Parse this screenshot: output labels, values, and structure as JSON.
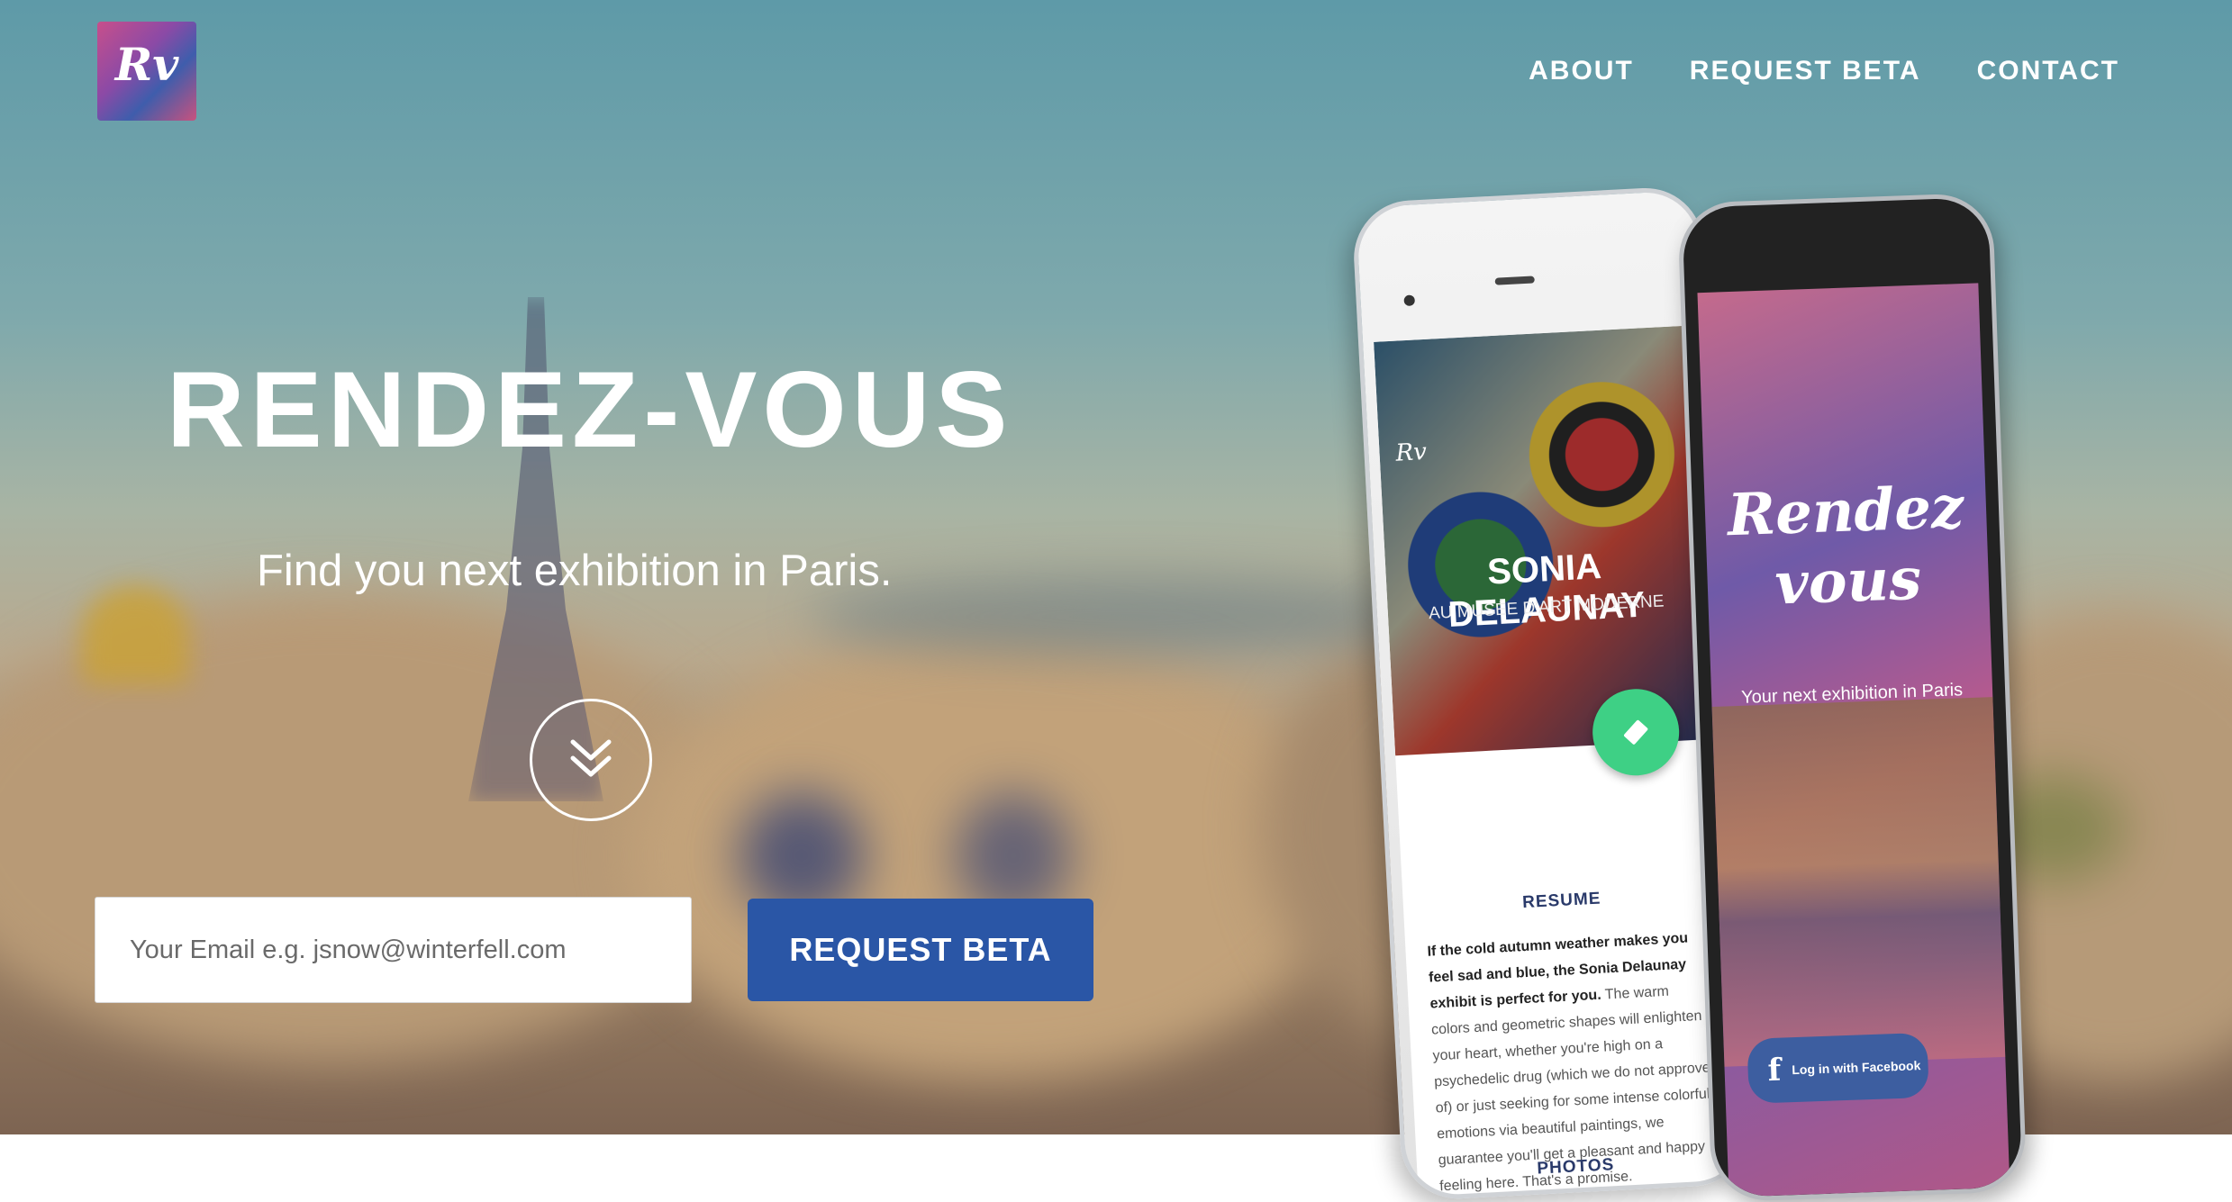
{
  "brand": {
    "logo_text": "Rv"
  },
  "nav": {
    "items": [
      "ABOUT",
      "REQUEST BETA",
      "CONTACT"
    ]
  },
  "hero": {
    "title": "RENDEZ-VOUS",
    "subtitle": "Find you next exhibition in Paris.",
    "scroll_icon": "double-chevron-down-icon",
    "email_placeholder": "Your Email e.g. jsnow@winterfell.com",
    "cta_label": "REQUEST BETA"
  },
  "phone_left": {
    "logo": "Rv",
    "exhibit_title": "SONIA DELAUNAY",
    "exhibit_subtitle": "AU MUSÉE D'ART MODERNE",
    "resume_heading": "RESUME",
    "resume_lead": "If the cold autumn weather makes you feel sad and blue, the Sonia Delaunay exhibit is perfect for you.",
    "resume_body": "The warm colors and geometric shapes will enlighten your heart, whether you're high on a psychedelic drug (which we do not approve of) or just seeking for some intense colorful emotions via beautiful paintings, we guarantee you'll get a pleasant and happy feeling here. That's a promise.",
    "photos_heading": "PHOTOS"
  },
  "phone_right": {
    "logo_line1": "Rendez",
    "logo_line2": "vous",
    "tagline": "Your next exhibition in Paris",
    "fb_label": "Log in with Facebook"
  },
  "colors": {
    "cta": "#2a56a6",
    "fab": "#3ed085",
    "facebook": "#3d5ea0"
  }
}
